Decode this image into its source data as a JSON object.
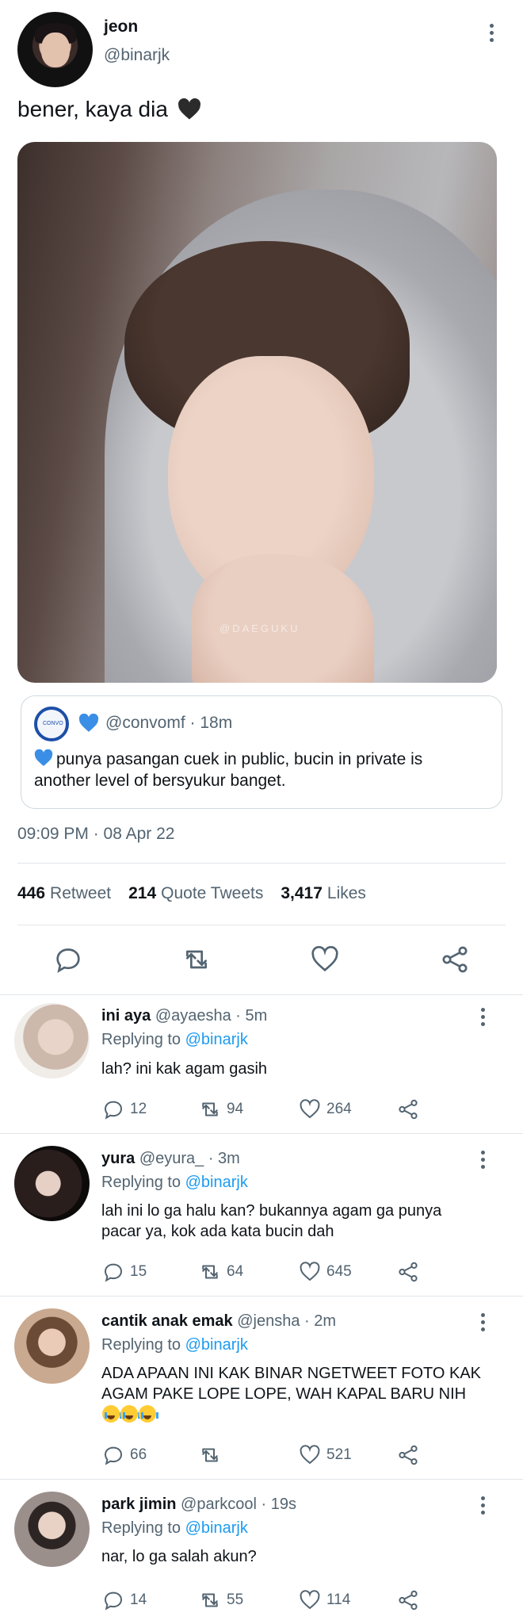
{
  "tweet": {
    "author_name": "jeon",
    "author_handle": "@binarjk",
    "text": "bener, kaya dia",
    "text_emoji": "black-heart-emoji",
    "photo_watermark": "@DAEGUKU",
    "quoted": {
      "emoji": "blue-heart-emoji",
      "handle_time": "@convomf · 18m",
      "text": "punya pasangan cuek in public, bucin in private is another level of bersyukur banget."
    },
    "timestamp": "09:09 PM · 08 Apr 22",
    "stats": {
      "retweets": "446",
      "retweets_label": "Retweet",
      "quotes": "214",
      "quotes_label": "Quote Tweets",
      "likes": "3,417",
      "likes_label": "Likes"
    }
  },
  "replies": [
    {
      "name": "ini aya",
      "handle_time": "@ayaesha · 5m",
      "replying_label": "Replying to",
      "replying_to": "@binarjk",
      "text": "lah? ini kak agam gasih",
      "comments": "12",
      "retweets": "94",
      "likes": "264"
    },
    {
      "name": "yura",
      "handle_time": "@eyura_ · 3m",
      "replying_label": "Replying to",
      "replying_to": "@binarjk",
      "text": "lah ini lo ga halu kan? bukannya agam ga punya pacar ya, kok ada kata bucin dah",
      "comments": "15",
      "retweets": "64",
      "likes": "645"
    },
    {
      "name": "cantik anak emak",
      "handle_time": "@jensha · 2m",
      "replying_label": "Replying to",
      "replying_to": "@binarjk",
      "text": "ADA APAAN INI KAK BINAR NGETWEET FOTO KAK AGAM PAKE LOPE LOPE, WAH KAPAL BARU NIH",
      "text_emoji": "loudly-crying-face-emoji",
      "comments": "66",
      "retweets": "",
      "likes": "521"
    },
    {
      "name": "park jimin",
      "handle_time": "@parkcool · 19s",
      "replying_label": "Replying to",
      "replying_to": "@binarjk",
      "text": "nar, lo ga salah akun?",
      "comments": "14",
      "retweets": "55",
      "likes": "114"
    }
  ],
  "colors": {
    "link": "#1d9bf0",
    "muted": "#536471",
    "text": "#0f1419",
    "divider": "#e1e6ea"
  }
}
